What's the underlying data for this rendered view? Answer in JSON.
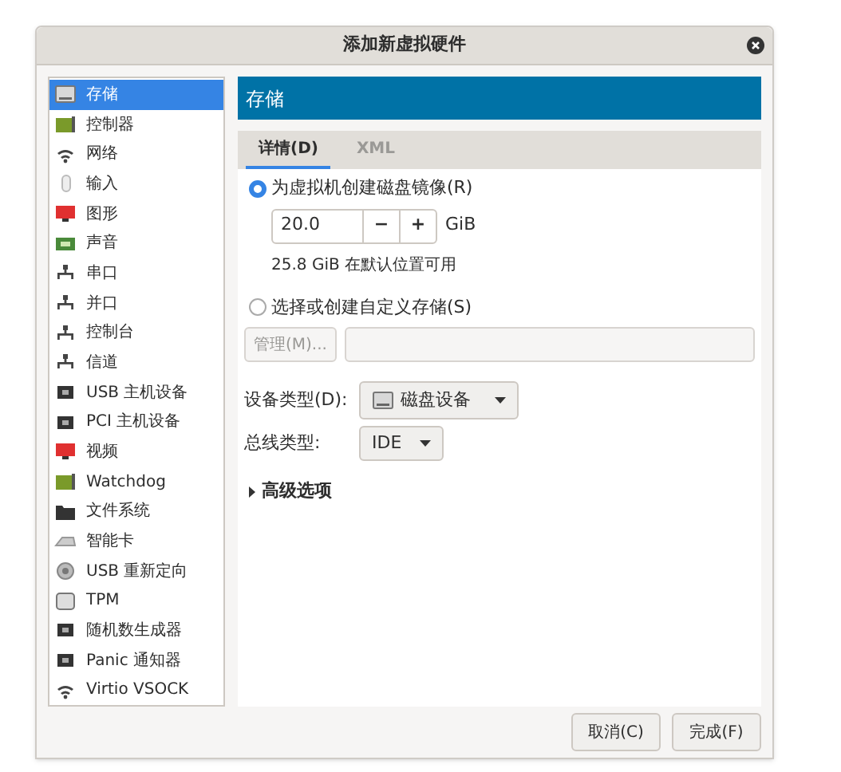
{
  "window": {
    "title": "添加新虚拟硬件"
  },
  "sidebar": {
    "items": [
      {
        "label": "存储",
        "selected": true
      },
      {
        "label": "控制器",
        "selected": false
      },
      {
        "label": "网络",
        "selected": false
      },
      {
        "label": "输入",
        "selected": false
      },
      {
        "label": "图形",
        "selected": false
      },
      {
        "label": "声音",
        "selected": false
      },
      {
        "label": "串口",
        "selected": false
      },
      {
        "label": "并口",
        "selected": false
      },
      {
        "label": "控制台",
        "selected": false
      },
      {
        "label": "信道",
        "selected": false
      },
      {
        "label": "USB 主机设备",
        "selected": false
      },
      {
        "label": "PCI 主机设备",
        "selected": false
      },
      {
        "label": "视频",
        "selected": false
      },
      {
        "label": "Watchdog",
        "selected": false
      },
      {
        "label": "文件系统",
        "selected": false
      },
      {
        "label": "智能卡",
        "selected": false
      },
      {
        "label": "USB 重新定向",
        "selected": false
      },
      {
        "label": "TPM",
        "selected": false
      },
      {
        "label": "随机数生成器",
        "selected": false
      },
      {
        "label": "Panic 通知器",
        "selected": false
      },
      {
        "label": "Virtio VSOCK",
        "selected": false
      }
    ]
  },
  "header": {
    "title": "存储"
  },
  "tabs": [
    {
      "label": "详情(D)",
      "selected": true
    },
    {
      "label": "XML",
      "selected": false
    }
  ],
  "storage": {
    "options": [
      {
        "label": "为虚拟机创建磁盘镜像(R)",
        "selected": true
      },
      {
        "label": "选择或创建自定义存储(S)",
        "selected": false
      }
    ],
    "size": {
      "value": "20.0",
      "minus": "−",
      "plus": "+",
      "unit": "GiB"
    },
    "available": "25.8 GiB 在默认位置可用",
    "manage_button": "管理(M)...",
    "device_type": {
      "label": "设备类型(D):",
      "value": "磁盘设备"
    },
    "bus_type": {
      "label": "总线类型:",
      "value": "IDE"
    },
    "advanced": {
      "label": "高级选项",
      "expanded": false
    }
  },
  "buttons": [
    "取消(C)",
    "完成(F)"
  ]
}
